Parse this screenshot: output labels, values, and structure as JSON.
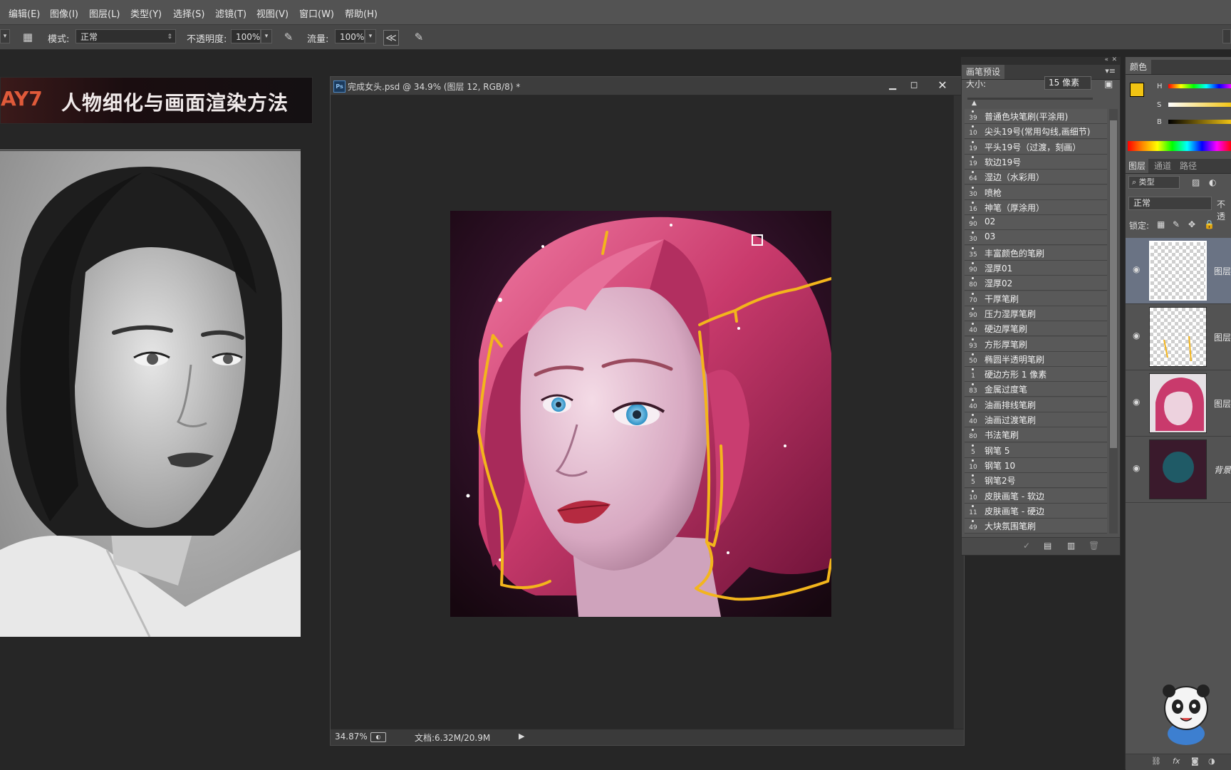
{
  "menu": [
    "编辑(E)",
    "图像(I)",
    "图层(L)",
    "类型(Y)",
    "选择(S)",
    "滤镜(T)",
    "视图(V)",
    "窗口(W)",
    "帮助(H)"
  ],
  "options": {
    "mode_label": "模式:",
    "mode_value": "正常",
    "opacity_label": "不透明度:",
    "opacity_value": "100%",
    "flow_label": "流量:",
    "flow_value": "100%"
  },
  "banner": {
    "day": "AY7",
    "title": "人物细化与画面渲染方法"
  },
  "document": {
    "title": "完成女头.psd @ 34.9% (图层 12, RGB/8) *",
    "zoom": "34.87%",
    "doc_size": "文档:6.32M/20.9M"
  },
  "brush_panel": {
    "tab": "画笔预设",
    "size_label": "大小:",
    "size_value": "15 像素",
    "brushes": [
      {
        "num": "39",
        "name": "普通色块笔刷(平涂用)"
      },
      {
        "num": "10",
        "name": "尖头19号(常用勾线,画细节)"
      },
      {
        "num": "19",
        "name": "平头19号（过渡，刻画）"
      },
      {
        "num": "19",
        "name": "软边19号"
      },
      {
        "num": "64",
        "name": "湿边（水彩用）"
      },
      {
        "num": "30",
        "name": "喷枪"
      },
      {
        "num": "16",
        "name": "神笔（厚涂用）"
      },
      {
        "num": "90",
        "name": "02"
      },
      {
        "num": "30",
        "name": "03"
      },
      {
        "num": "35",
        "name": "丰富颜色的笔刷"
      },
      {
        "num": "90",
        "name": "湿厚01"
      },
      {
        "num": "80",
        "name": "湿厚02"
      },
      {
        "num": "70",
        "name": "干厚笔刷"
      },
      {
        "num": "90",
        "name": "压力湿厚笔刷"
      },
      {
        "num": "40",
        "name": "硬边厚笔刷"
      },
      {
        "num": "93",
        "name": "方形厚笔刷"
      },
      {
        "num": "50",
        "name": "椭圆半透明笔刷"
      },
      {
        "num": "1",
        "name": "硬边方形 1 像素"
      },
      {
        "num": "83",
        "name": "金属过度笔"
      },
      {
        "num": "40",
        "name": "油画排线笔刷"
      },
      {
        "num": "40",
        "name": "油画过渡笔刷"
      },
      {
        "num": "80",
        "name": "书法笔刷"
      },
      {
        "num": "5",
        "name": "钢笔 5"
      },
      {
        "num": "10",
        "name": "钢笔 10"
      },
      {
        "num": "5",
        "name": "钢笔2号"
      },
      {
        "num": "10",
        "name": "皮肤画笔 - 软边"
      },
      {
        "num": "11",
        "name": "皮肤画笔 - 硬边"
      },
      {
        "num": "49",
        "name": "大块氛围笔刷"
      }
    ]
  },
  "color_panel": {
    "tab": "颜色",
    "h": "H",
    "s": "S",
    "b": "B",
    "fg": "#f2c413",
    "bg": "#1f3cc8"
  },
  "layers_panel": {
    "tabs": [
      "图层",
      "通道",
      "路径"
    ],
    "filter": "类型",
    "blend": "正常",
    "opacity_label": "不透",
    "lock_label": "锁定:",
    "layers": [
      {
        "name": "图层"
      },
      {
        "name": "图层"
      },
      {
        "name": "图层"
      },
      {
        "name": "背景"
      }
    ]
  },
  "accent_color": "#f3b51c"
}
